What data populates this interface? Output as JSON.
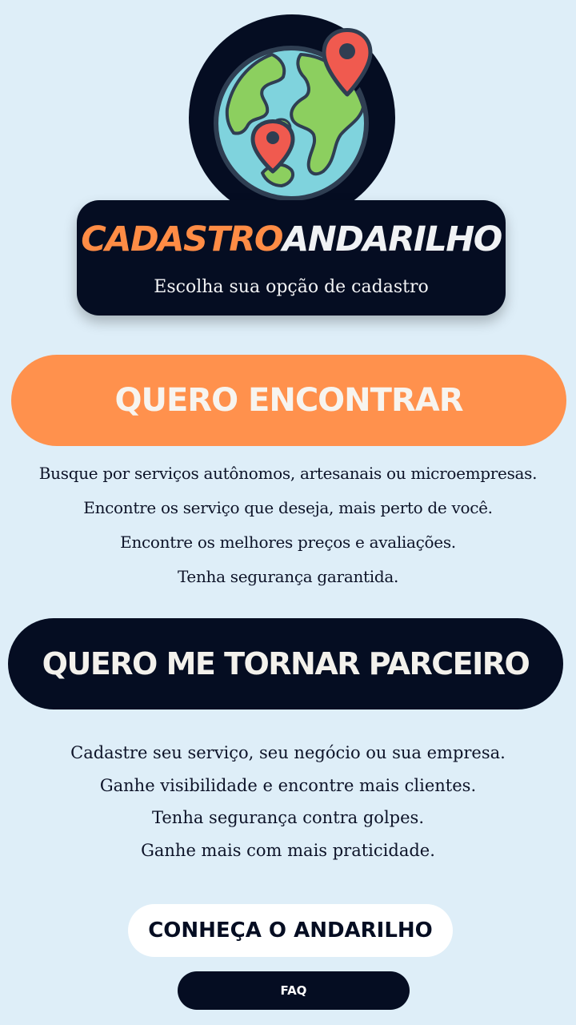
{
  "logo": {
    "icon": "globe-with-map-pins",
    "brand_part1": "CADASTRO",
    "brand_part2": "ANDARILHO"
  },
  "subtitle": "Escolha sua opção de cadastro",
  "find_section": {
    "button_label": "QUERO ENCONTRAR",
    "lines": [
      "Busque por serviços autônomos, artesanais ou microempresas.",
      "Encontre os serviço que deseja, mais perto de você.",
      "Encontre os melhores preços e avaliações.",
      "Tenha segurança garantida."
    ]
  },
  "partner_section": {
    "button_label": "QUERO ME TORNAR PARCEIRO",
    "lines": [
      "Cadastre seu serviço, seu negócio ou sua empresa.",
      "Ganhe visibilidade e encontre mais clientes.",
      "Tenha segurança contra golpes.",
      "Ganhe mais com mais praticidade."
    ]
  },
  "footer": {
    "know_button": "CONHEÇA O ANDARILHO",
    "faq_button": "FAQ"
  },
  "colors": {
    "background": "#deeef8",
    "navy": "#050d22",
    "orange": "#ff914d",
    "pin_red": "#f05a4f",
    "globe_ocean": "#7fd3dd",
    "globe_land": "#8ccf5f"
  }
}
